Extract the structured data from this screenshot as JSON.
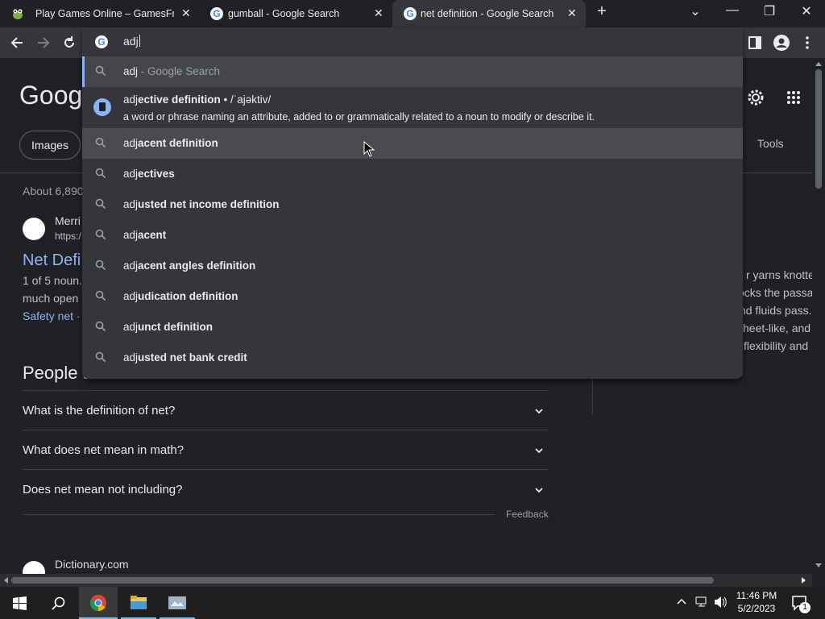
{
  "tabs": [
    {
      "title": "Play Games Online – GamesFrog",
      "close": "✕",
      "icon": "frog-icon"
    },
    {
      "title": "gumball - Google Search",
      "close": "✕",
      "icon": "google-icon"
    },
    {
      "title": "net definition - Google Search",
      "close": "✕",
      "icon": "google-icon",
      "active": true
    }
  ],
  "new_tab": "+",
  "window_controls": {
    "dropdown": "⌄",
    "minimize": "—",
    "maximize": "❐",
    "close": "✕"
  },
  "omnibox": {
    "text": "adj"
  },
  "suggestions": [
    {
      "prefix": "adj",
      "rest": "",
      "sub": " - Google Search"
    },
    {
      "prefix": "adj",
      "rest": "ective definition",
      "extra": " • /ˈajəktiv/",
      "line2": "a word or phrase naming an attribute, added to or grammatically related to a noun to modify or describe it."
    },
    {
      "prefix": "adj",
      "rest": "acent definition"
    },
    {
      "prefix": "adj",
      "rest": "ectives"
    },
    {
      "prefix": "adj",
      "rest": "usted net income definition"
    },
    {
      "prefix": "adj",
      "rest": "acent"
    },
    {
      "prefix": "adj",
      "rest": "acent angles definition"
    },
    {
      "prefix": "adj",
      "rest": "udication definition"
    },
    {
      "prefix": "adj",
      "rest": "unct definition"
    },
    {
      "prefix": "adj",
      "rest": "usted net bank credit"
    }
  ],
  "page": {
    "logo": "Googl",
    "chip_images": "Images",
    "tools": "Tools",
    "about": "About 6,890",
    "result": {
      "site": "Merri",
      "url": "https:/",
      "title": "Net Defi",
      "snip1": "1 of 5 noun.",
      "snip2": "much open",
      "link": "Safety net ·"
    },
    "people_also_ask": "People a",
    "questions": [
      "What is the definition of net?",
      "What does net mean in math?",
      "Does net mean not including?"
    ],
    "feedback": "Feedback",
    "next_site": "Dictionary.com",
    "right_panel": [
      "r yarns knotted",
      "ocks the passa",
      "nd fluids pass.",
      "heet-like, and p",
      "flexibility and"
    ]
  },
  "clock": {
    "time": "11:46 PM",
    "date": "5/2/2023"
  },
  "notifications": "1"
}
